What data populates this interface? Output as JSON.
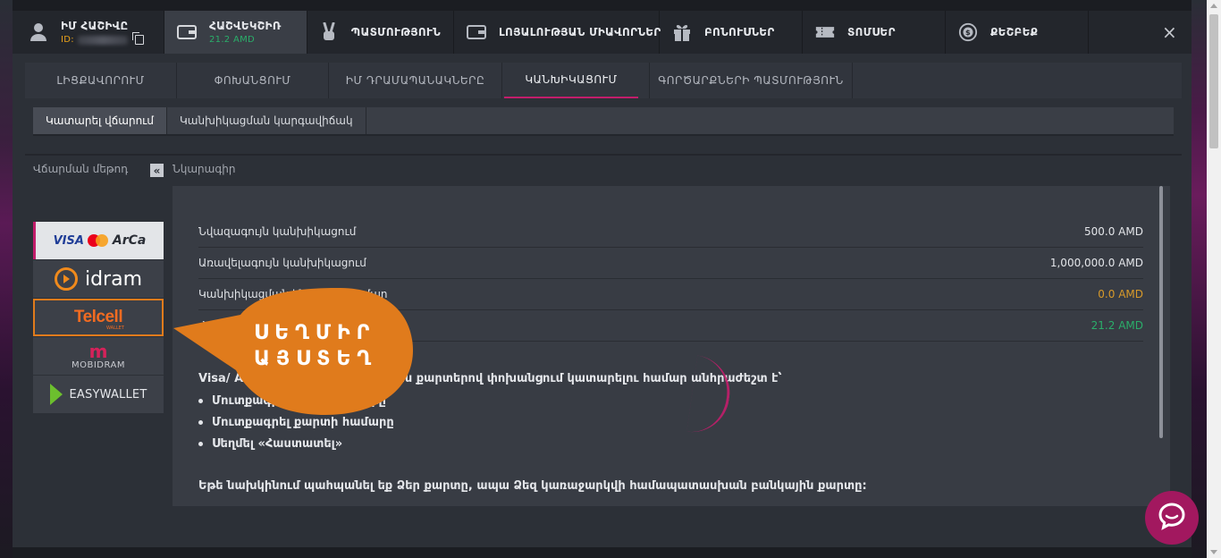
{
  "nav": {
    "user_name": "ԻՄ ՀԱՇԻՎԸ",
    "user_id_label": "ID:",
    "accounts_label": "ՀԱՇՎԵԿՇԻՌ",
    "accounts_balance": "21.2 AMD",
    "history": "ՊԱՏՄՈՒԹՅՈՒՆ",
    "loyalty": "ԼՈՅԱԼՈՒԹՅԱՆ ՄԻԱՎՈՐՆԵՐ",
    "bonuses": "ԲՈՆՈՒՍՆԵՐ",
    "tickets": "ՏՈՄՍԵՐ",
    "cashback": "ՔԵՇԲԵՔ",
    "close": "×"
  },
  "subtabs": {
    "t1": "ԼԻՑՔԱՎՈՐՈՒՄ",
    "t2": "ՓՈԽԱՆՑՈՒՄ",
    "t3": "ԻՄ ԴՐԱՄԱՊԱՆԱԿՆԵՐԸ",
    "t4": "ԿԱՆԽԻԿԱՑՈՒՄ",
    "t5": "ԳՈՐԾԱՐՔՆԵՐԻ ՊԱՏՄՈՒԹՅՈՒՆ"
  },
  "actions": {
    "make_payment": "Կատարել վճարում",
    "status": "Կանխիկացման կարգավիճակ"
  },
  "left_label": "Վճարման մեթոդ",
  "collapse": "«",
  "desc_label": "Նկարագիր",
  "methods": {
    "visa": "VISA",
    "arca": "ArCa",
    "idram": "idram",
    "telcell": "Telcell",
    "telcell_sub": "WALLET",
    "mobi": "MOBIDRAM",
    "easy": "EASYWALLET"
  },
  "rows": [
    {
      "label": "Նվազագույն կանխիկացում",
      "value": "500.0 AMD"
    },
    {
      "label": "Առավելագույն կանխիկացում",
      "value": "1,000,000.0 AMD"
    },
    {
      "label": "Կանխիկացման ենթակա գումար",
      "value": "0.0 AMD"
    },
    {
      "label": "Հաշվեկշիռ",
      "value": "21.2 AMD"
    }
  ],
  "instructions": {
    "lead": "Visa/ ArCa/MasterCard  բանկային քարտերով փոխանցում կատարելու համար անհրաժեշտ է՝",
    "items": [
      "Մուտքագրել գումարի չափը",
      "Մուտքագրել քարտի համարը",
      "Սեղմել  «Հաստատել»"
    ],
    "foot": "Եթե նախկինում պահպանել եք Ձեր քարտը, ապա Ձեզ կառաջարկվի համապատասխան բանկային քարտը:"
  },
  "callout": {
    "line1": "ՍԵՂՄԻՐ",
    "line2": "ԱՅՍՏԵՂ"
  },
  "colors": {
    "accent": "#c21d6b",
    "orange": "#e07b1c",
    "green": "#2aae6a"
  }
}
